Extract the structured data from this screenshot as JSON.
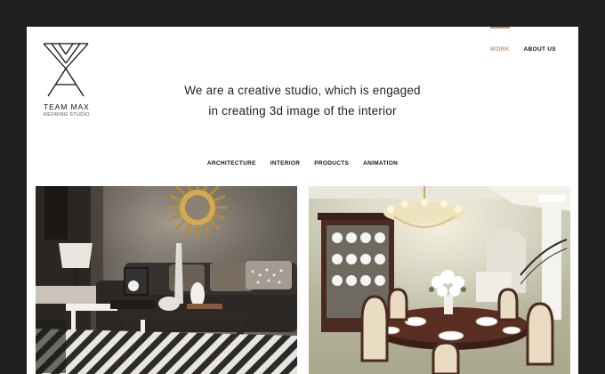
{
  "brand": {
    "logo_icon": "team-max-monogram",
    "name": "TEAM MAX",
    "subtitle": "REDRING STUDIO"
  },
  "nav": {
    "items": [
      {
        "label": "WORK",
        "active": true
      },
      {
        "label": "ABOUT US",
        "active": false
      }
    ],
    "accent_color": "#c8966a"
  },
  "hero": {
    "line1": "We are a creative studio, which is engaged",
    "line2": "in creating 3d image of the interior"
  },
  "filters": {
    "items": [
      "ARCHITECTURE",
      "INTERIOR",
      "PRODUCTS",
      "ANIMATION"
    ]
  },
  "gallery": {
    "items": [
      {
        "scene": "living-room-render"
      },
      {
        "scene": "dining-room-render"
      }
    ]
  },
  "colors": {
    "outer_background": "#1f1f1f",
    "page_background": "#ffffff"
  }
}
